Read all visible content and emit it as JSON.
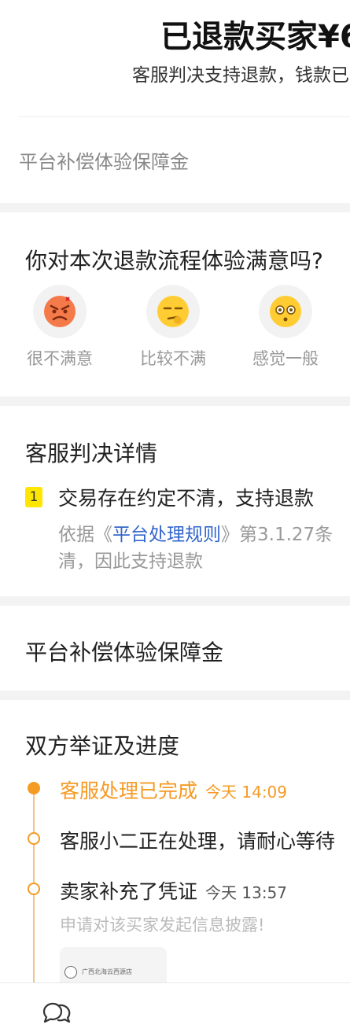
{
  "header": {
    "title": "已退款买家¥6",
    "subtitle": "客服判决支持退款，钱款已"
  },
  "compensation_top": "平台补偿体验保障金",
  "satisfaction": {
    "title": "你对本次退款流程体验满意吗?",
    "options": [
      {
        "label": "很不满意",
        "icon": "angry-face-icon"
      },
      {
        "label": "比较不满",
        "icon": "unamused-face-icon"
      },
      {
        "label": "感觉一般",
        "icon": "neutral-face-icon"
      }
    ]
  },
  "judgment": {
    "title": "客服判决详情",
    "item_number": "1",
    "reason": "交易存在约定不清，支持退款",
    "basis_prefix": "依据《",
    "basis_link": "平台处理规则",
    "basis_suffix": "》第3.1.27条",
    "basis_line2": "清，因此支持退款"
  },
  "compensation_section_title": "平台补偿体验保障金",
  "evidence": {
    "title": "双方举证及进度",
    "items": [
      {
        "text": "客服处理已完成",
        "time": "今天 14:09",
        "active": true
      },
      {
        "text": "客服小二正在处理，请耐心等待",
        "time": "",
        "active": false
      },
      {
        "text": "卖家补充了凭证",
        "time": "今天 13:57",
        "active": false,
        "sub": "申请对该买家发起信息披露!"
      }
    ],
    "thumbnail_text": "广西北海云西源店"
  },
  "bottom_bar": {
    "icon": "chat-bubbles-icon"
  },
  "colors": {
    "accent": "#f59a23",
    "link": "#3366cc",
    "badge": "#ffe600",
    "gap": "#f3f3f3"
  }
}
